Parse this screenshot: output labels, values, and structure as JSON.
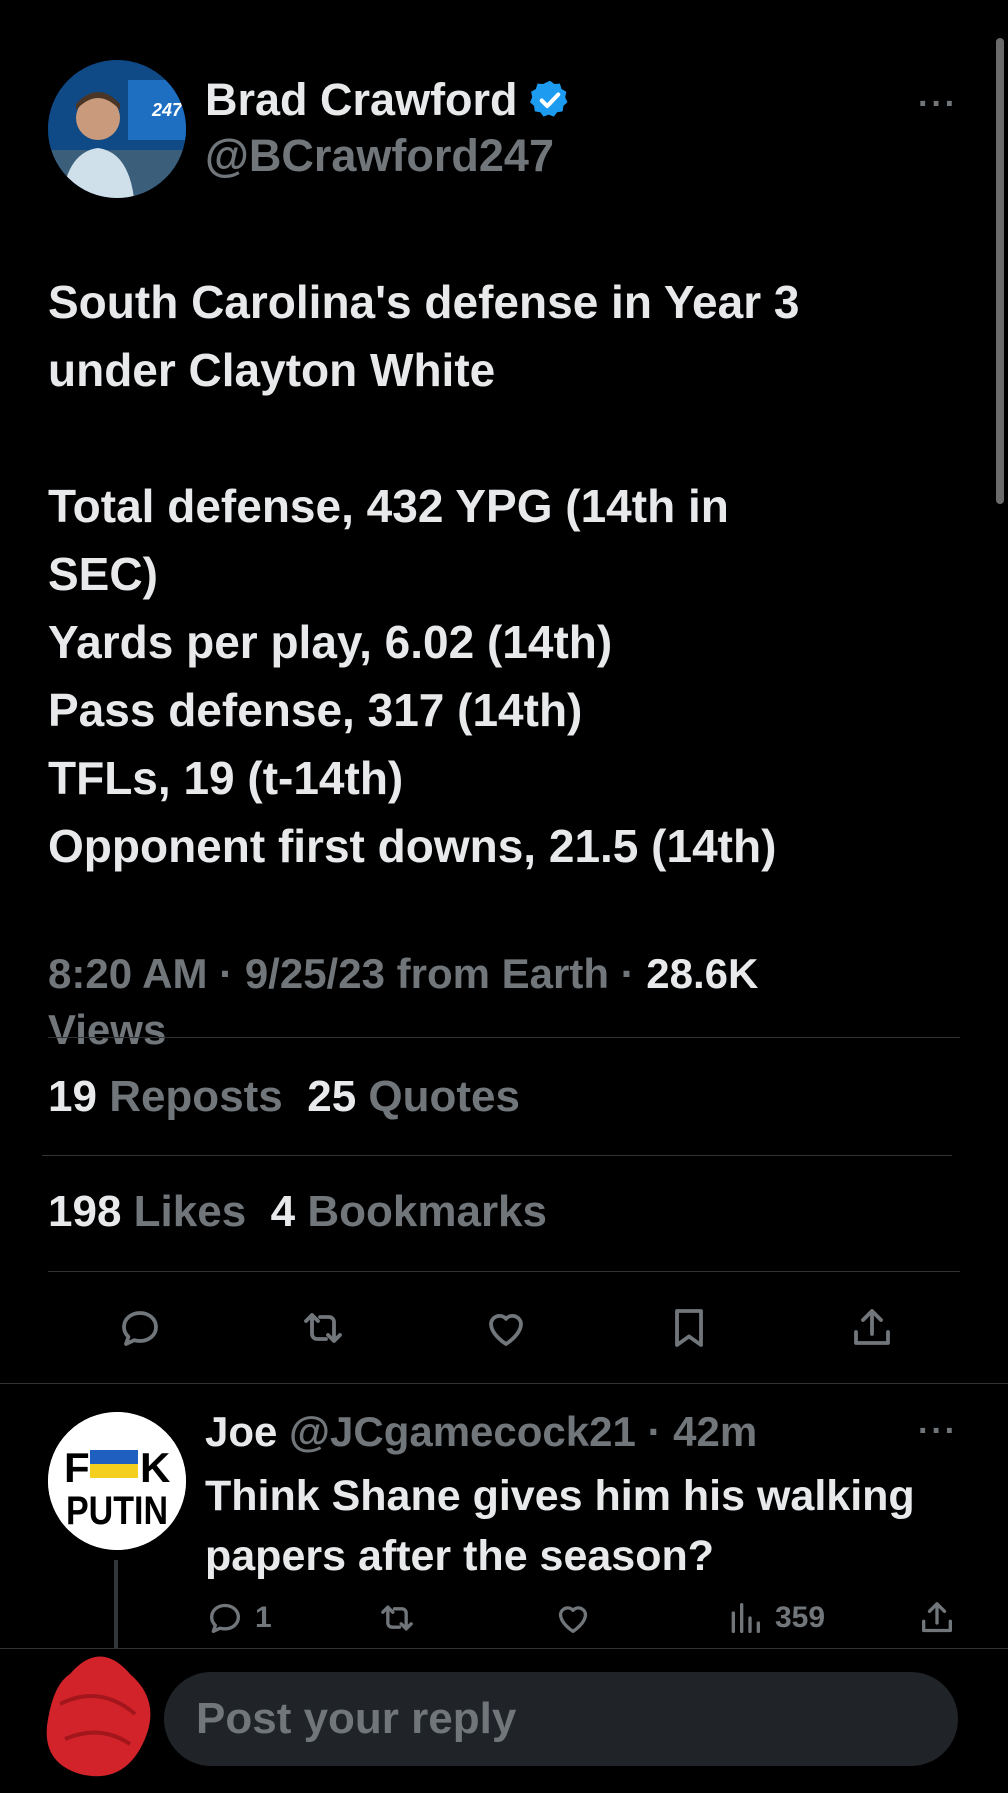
{
  "tweet": {
    "author_name": "Brad Crawford",
    "handle": "@BCrawford247",
    "avatar_logo_text": "247",
    "lines": [
      "South Carolina's defense in Year 3",
      "under Clayton White",
      "",
      "Total defense, 432 YPG (14th in",
      "SEC)",
      "Yards per play, 6.02 (14th)",
      "Pass defense, 317 (14th)",
      "TFLs, 19 (t-14th)",
      "Opponent first downs, 21.5 (14th)"
    ],
    "timestamp": "8:20 AM · 9/25/23 from Earth · ",
    "views_count": "28.6K",
    "views_label": "Views",
    "reposts_count": "19",
    "reposts_label": "Reposts",
    "quotes_count": "25",
    "quotes_label": "Quotes",
    "likes_count": "198",
    "likes_label": "Likes",
    "bookmarks_count": "4",
    "bookmarks_label": "Bookmarks"
  },
  "reply": {
    "name": "Joe",
    "handle_time": "@JCgamecock21 · 42m",
    "avatar_text_top": "F",
    "avatar_text_k": "K",
    "avatar_text_bottom": "PUTIN",
    "text": "Think Shane gives him his walking papers after the season?",
    "reply_count": "1",
    "views": "359"
  },
  "compose": {
    "placeholder": "Post your reply"
  },
  "colors": {
    "background": "#000000",
    "text": "#e7e9ea",
    "muted": "#71767b",
    "verified": "#1d9bf0",
    "scribble": "#d2232a"
  },
  "icons": [
    "more-icon",
    "verified-badge-icon",
    "reply-icon",
    "repost-icon",
    "like-icon",
    "bookmark-icon",
    "share-icon",
    "analytics-icon"
  ]
}
